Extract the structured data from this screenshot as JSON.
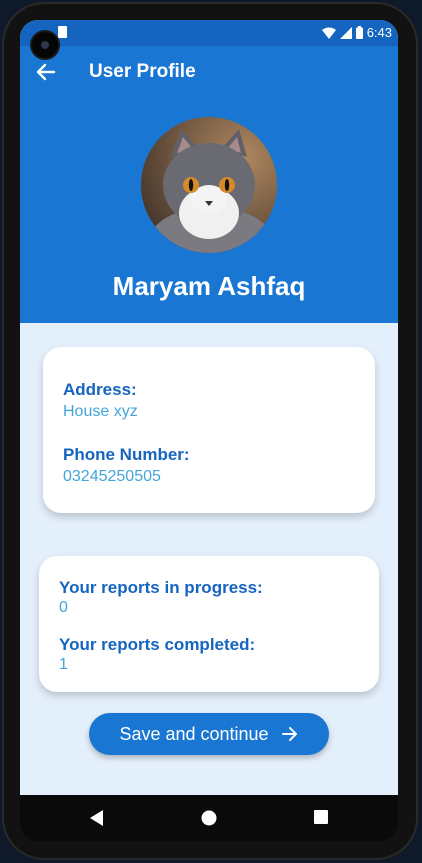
{
  "status_bar": {
    "time": "6:43",
    "icons": [
      "wifi-icon",
      "signal-icon",
      "battery-icon"
    ]
  },
  "app_bar": {
    "title": "User Profile",
    "back_icon": "arrow-left-icon"
  },
  "profile": {
    "name": "Maryam Ashfaq",
    "avatar": "cat-photo"
  },
  "contact_card": {
    "address_label": "Address:",
    "address_value": "House xyz",
    "phone_label": "Phone Number:",
    "phone_value": "03245250505"
  },
  "reports_card": {
    "in_progress_label": "Your reports in progress:",
    "in_progress_value": "0",
    "completed_label": "Your reports completed:",
    "completed_value": "1"
  },
  "actions": {
    "save_label": "Save and continue",
    "save_icon": "arrow-right-icon"
  },
  "colors": {
    "primary": "#1976d2",
    "label": "#1565c0",
    "value": "#42a5d8",
    "background": "#e3effb"
  }
}
